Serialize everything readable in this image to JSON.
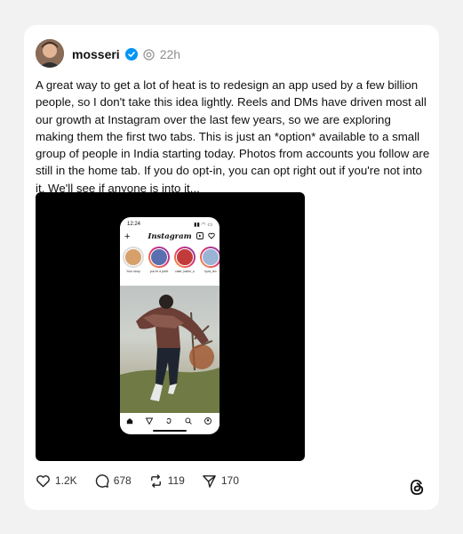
{
  "post": {
    "username": "mosseri",
    "time": "22h",
    "text": "A great way to get a lot of heat is to redesign an app used by a few billion people, so I don't take this idea lightly. Reels and DMs have driven most all our growth at Instagram over the last few years, so we are exploring making them the first two tabs. This is just an *option* available to a small group of people in India starting today. Photos from accounts you follow are still in the home tab. If you do opt-in, you can opt right out if you're not into it. We'll see if anyone is into it..."
  },
  "media": {
    "status_time": "12:24",
    "app_title": "Instagram",
    "stories": [
      {
        "label": "Your story"
      },
      {
        "label": "you're a pixel"
      },
      {
        "label": "cake_baker_s"
      },
      {
        "label": "kyra_leo"
      }
    ]
  },
  "actions": {
    "likes": "1.2K",
    "replies": "678",
    "reposts": "119",
    "shares": "170"
  },
  "icons": {
    "verified": "verified-badge-icon",
    "thread": "thread-icon",
    "like": "heart-icon",
    "reply": "comment-icon",
    "repost": "repost-icon",
    "share": "send-icon",
    "brand": "threads-logo-icon"
  },
  "colors": {
    "verified": "#0095f6",
    "background": "#f2f2f2",
    "card": "#ffffff"
  }
}
